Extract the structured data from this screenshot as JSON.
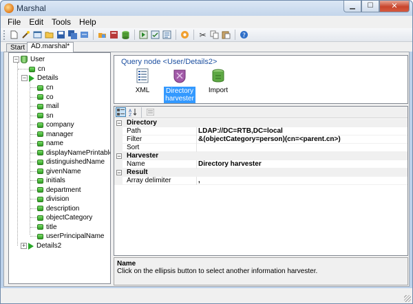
{
  "window": {
    "title": "Marshal",
    "minimize_icon": "minimize-icon",
    "maximize_icon": "maximize-icon",
    "close_icon": "close-icon"
  },
  "menu": {
    "items": [
      {
        "label": "File",
        "accel": "F"
      },
      {
        "label": "Edit",
        "accel": "E"
      },
      {
        "label": "Tools",
        "accel": "T"
      },
      {
        "label": "Help",
        "accel": "H"
      }
    ]
  },
  "toolbar": {
    "buttons": [
      "new-icon",
      "wand-icon",
      "open-window-icon",
      "open-folder-icon",
      "save-icon",
      "save-all-icon",
      "export-icon",
      "import-icon",
      "db-icon",
      "run-icon",
      "validate-icon",
      "preview-icon",
      "plugin-icon",
      "cut-icon",
      "copy-icon",
      "paste-icon",
      "help-icon"
    ]
  },
  "tabs": [
    {
      "label": "Start",
      "active": false
    },
    {
      "label": "AD.marshal*",
      "active": true
    }
  ],
  "tree": {
    "root": "User",
    "root_children": [
      "cn"
    ],
    "details_label": "Details",
    "details_children": [
      "cn",
      "co",
      "mail",
      "sn",
      "company",
      "manager",
      "name",
      "displayNamePrintable",
      "distinguishedName",
      "givenName",
      "initials",
      "department",
      "division",
      "description",
      "objectCategory",
      "title",
      "userPrincipalName"
    ],
    "details2_label": "Details2"
  },
  "query_node": {
    "header": "Query node <User/Details2>",
    "items": [
      {
        "label": "XML",
        "icon": "xml-icon",
        "selected": false
      },
      {
        "label": "Directory harvester",
        "icon": "directory-harvester-icon",
        "selected": true
      },
      {
        "label": "Import",
        "icon": "import-icon",
        "selected": false
      }
    ]
  },
  "properties": {
    "categories": [
      {
        "name": "Directory",
        "items": [
          {
            "name": "Path",
            "value": "LDAP://DC=RTB,DC=local"
          },
          {
            "name": "Filter",
            "value": "&(objectCategory=person)(cn=<parent.cn>)"
          },
          {
            "name": "Sort",
            "value": ""
          }
        ]
      },
      {
        "name": "Harvester",
        "items": [
          {
            "name": "Name",
            "value": "Directory harvester"
          }
        ]
      },
      {
        "name": "Result",
        "items": [
          {
            "name": "Array delimiter",
            "value": ","
          }
        ]
      }
    ]
  },
  "description": {
    "title": "Name",
    "text": "Click on the ellipsis button to select another information harvester."
  },
  "colors": {
    "selection": "#3399ff",
    "node_green": "#2e9b22",
    "header_blue": "#1c4fa0"
  }
}
